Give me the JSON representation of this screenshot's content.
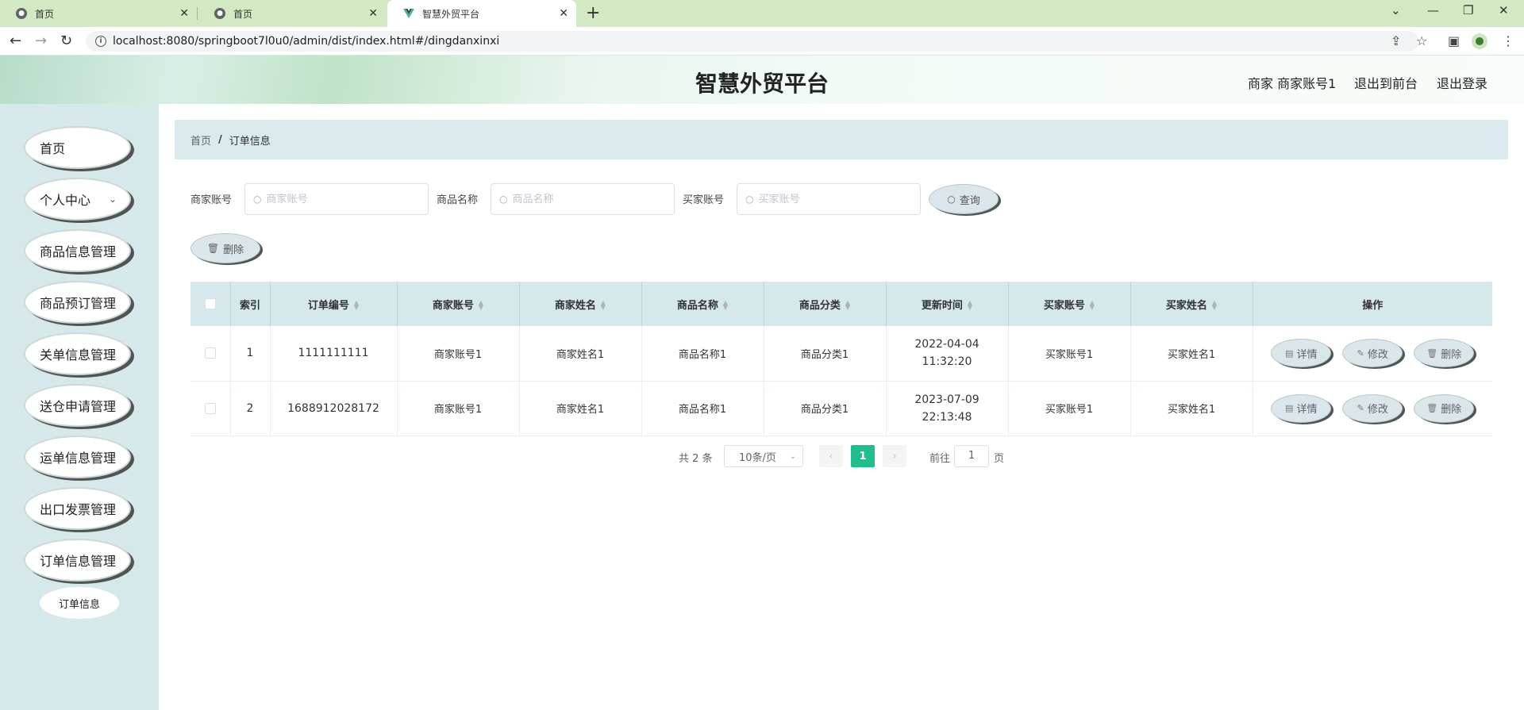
{
  "browser": {
    "tabs": [
      {
        "title": "首页",
        "active": false
      },
      {
        "title": "首页",
        "active": false
      },
      {
        "title": "智慧外贸平台",
        "active": true
      }
    ],
    "url": "localhost:8080/springboot7l0u0/admin/dist/index.html#/dingdanxinxi"
  },
  "header": {
    "title": "智慧外贸平台",
    "user": "商家 商家账号1",
    "to_front": "退出到前台",
    "logout": "退出登录"
  },
  "sidebar": {
    "items": [
      {
        "label": "首页"
      },
      {
        "label": "个人中心"
      },
      {
        "label": "商品信息管理"
      },
      {
        "label": "商品预订管理"
      },
      {
        "label": "关单信息管理"
      },
      {
        "label": "送仓申请管理"
      },
      {
        "label": "运单信息管理"
      },
      {
        "label": "出口发票管理"
      },
      {
        "label": "订单信息管理"
      }
    ],
    "sub_item": "订单信息"
  },
  "breadcrumb": {
    "home": "首页",
    "separator": "/",
    "current": "订单信息"
  },
  "search": {
    "merchant_label": "商家账号",
    "merchant_placeholder": "商家账号",
    "product_label": "商品名称",
    "product_placeholder": "商品名称",
    "buyer_label": "买家账号",
    "buyer_placeholder": "买家账号",
    "query_button": "查询"
  },
  "toolbar": {
    "delete_button": "删除"
  },
  "table": {
    "headers": {
      "index": "索引",
      "order_no": "订单编号",
      "merchant_account": "商家账号",
      "merchant_name": "商家姓名",
      "product_name": "商品名称",
      "product_category": "商品分类",
      "update_time": "更新时间",
      "buyer_account": "买家账号",
      "buyer_name": "买家姓名",
      "actions": "操作"
    },
    "rows": [
      {
        "index": "1",
        "order_no": "1111111111",
        "merchant_account": "商家账号1",
        "merchant_name": "商家姓名1",
        "product_name": "商品名称1",
        "product_category": "商品分类1",
        "update_time": "2022-04-04 11:32:20",
        "buyer_account": "买家账号1",
        "buyer_name": "买家姓名1"
      },
      {
        "index": "2",
        "order_no": "1688912028172",
        "merchant_account": "商家账号1",
        "merchant_name": "商家姓名1",
        "product_name": "商品名称1",
        "product_category": "商品分类1",
        "update_time": "2023-07-09 22:13:48",
        "buyer_account": "买家账号1",
        "buyer_name": "买家姓名1"
      }
    ],
    "actions": {
      "detail": "详情",
      "edit": "修改",
      "delete": "删除"
    }
  },
  "pagination": {
    "total": "共 2 条",
    "page_size": "10条/页",
    "current_page": "1",
    "goto_label": "前往",
    "goto_value": "1",
    "page_unit": "页"
  },
  "colors": {
    "accent": "#1fbe8d",
    "sidebar_bg": "#d6e9ea",
    "header_bg": "#d9e9ec"
  }
}
